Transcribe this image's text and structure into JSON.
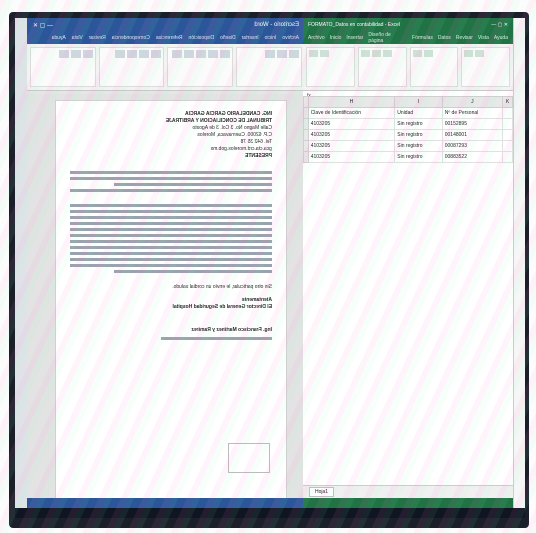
{
  "word": {
    "title": "Escritorio - Word",
    "tabs": [
      "Archivo",
      "Inicio",
      "Insertar",
      "Diseño",
      "Disposición",
      "Referencias",
      "Correspondencia",
      "Revisar",
      "Vista",
      "Ayuda"
    ],
    "document": {
      "heading_lines": [
        "ING. CANDELARIO GARCIA GARCIA",
        "TRIBUNAL DE CONCILIACIÓN Y ARBITRAJE",
        "Calle Magno No. 3 Col. 3 de Agosto",
        "C.P. 62000. Cuernavaca, Morelos",
        "Tel. 642 35 78",
        "gca.cta.crd.morelos.gob.mx",
        "PRESENTE"
      ],
      "closing_lines": [
        "Sin otro particular, le envío un cordial saludo.",
        "Atentamente",
        "El Director General de Seguridad Hospital"
      ],
      "signature": "Ing. Francisco Martínez y Ramírez"
    }
  },
  "excel": {
    "title": "FORMATO_Datos en contabilidad - Excel",
    "tabs": [
      "Archivo",
      "Inicio",
      "Insertar",
      "Diseño de página",
      "Fórmulas",
      "Datos",
      "Revisar",
      "Vista",
      "Ayuda"
    ],
    "columns": [
      "H",
      "I",
      "J",
      "K"
    ],
    "headers": [
      "Clave de Identificación",
      "Unidad",
      "Nº de Personal"
    ],
    "rows": [
      [
        "4103205",
        "Sin registro",
        "00152895"
      ],
      [
        "4103205",
        "Sin registro",
        "00148001"
      ],
      [
        "4103205",
        "Sin registro",
        "00087293"
      ],
      [
        "4103205",
        "Sin registro",
        "00883522"
      ]
    ],
    "sheet_tab": "Hoja1"
  },
  "colors": {
    "word_blue": "#2b579a",
    "excel_green": "#217346"
  }
}
